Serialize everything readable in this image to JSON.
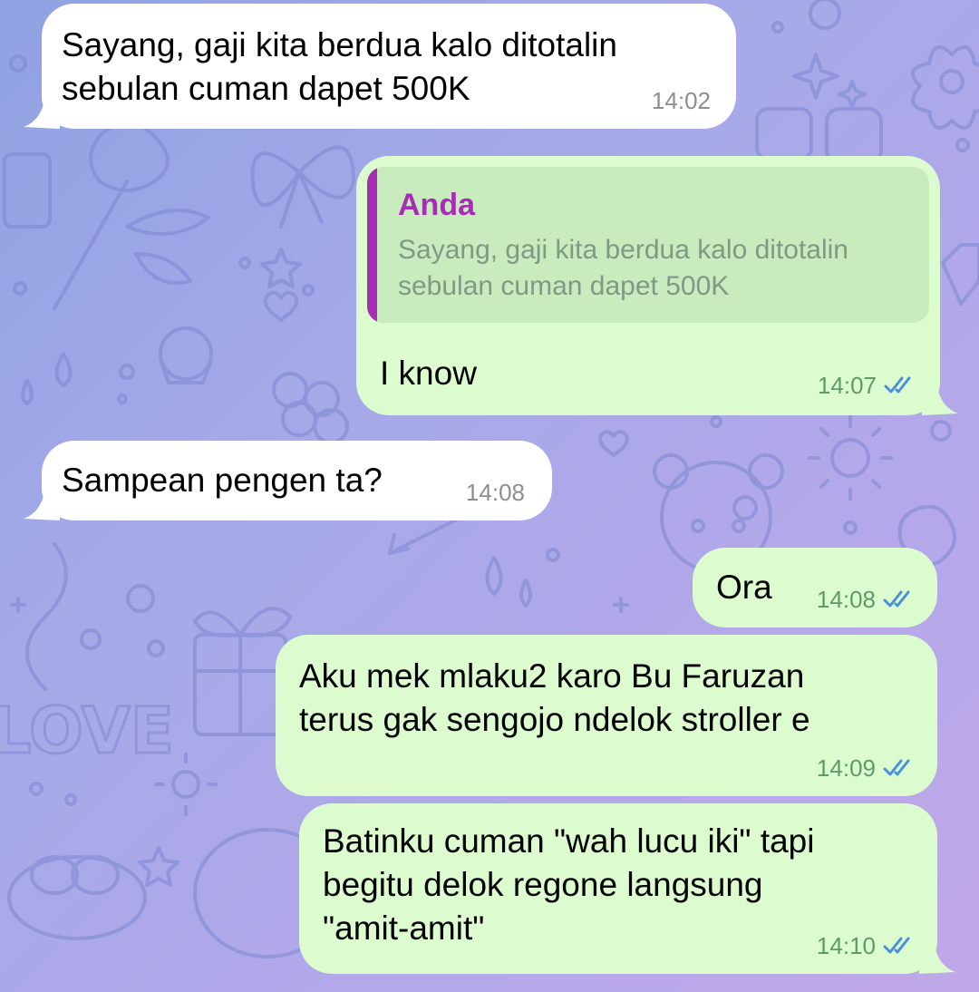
{
  "chat": {
    "messages": [
      {
        "direction": "incoming",
        "text": "Sayang, gaji kita berdua kalo ditotalin\nsebulan cuman dapet 500K",
        "time": "14:02"
      },
      {
        "direction": "outgoing",
        "reply_to": {
          "sender": "Anda",
          "text": "Sayang, gaji kita berdua kalo ditotalin\nsebulan cuman dapet 500K"
        },
        "text": "I know",
        "time": "14:07",
        "status": "read"
      },
      {
        "direction": "incoming",
        "text": "Sampean pengen ta?",
        "time": "14:08"
      },
      {
        "direction": "outgoing",
        "text": "Ora",
        "time": "14:08",
        "status": "read"
      },
      {
        "direction": "outgoing",
        "text": "Aku mek mlaku2 karo Bu Faruzan\nterus gak sengojo ndelok stroller e",
        "time": "14:09",
        "status": "read"
      },
      {
        "direction": "outgoing",
        "text": "Batinku cuman \"wah lucu iki\" tapi\nbegitu delok regone langsung\n\"amit-amit\"",
        "time": "14:10",
        "status": "read"
      }
    ]
  },
  "theme": {
    "incoming_bubble": "#ffffff",
    "outgoing_bubble": "#dcfccf",
    "reply_accent": "#a52eb5",
    "read_ticks": "#4a8fd9",
    "background_gradient": [
      "#8fa2e2",
      "#c0a8e8"
    ]
  },
  "icons": {
    "read_status": "double-check-icon"
  }
}
